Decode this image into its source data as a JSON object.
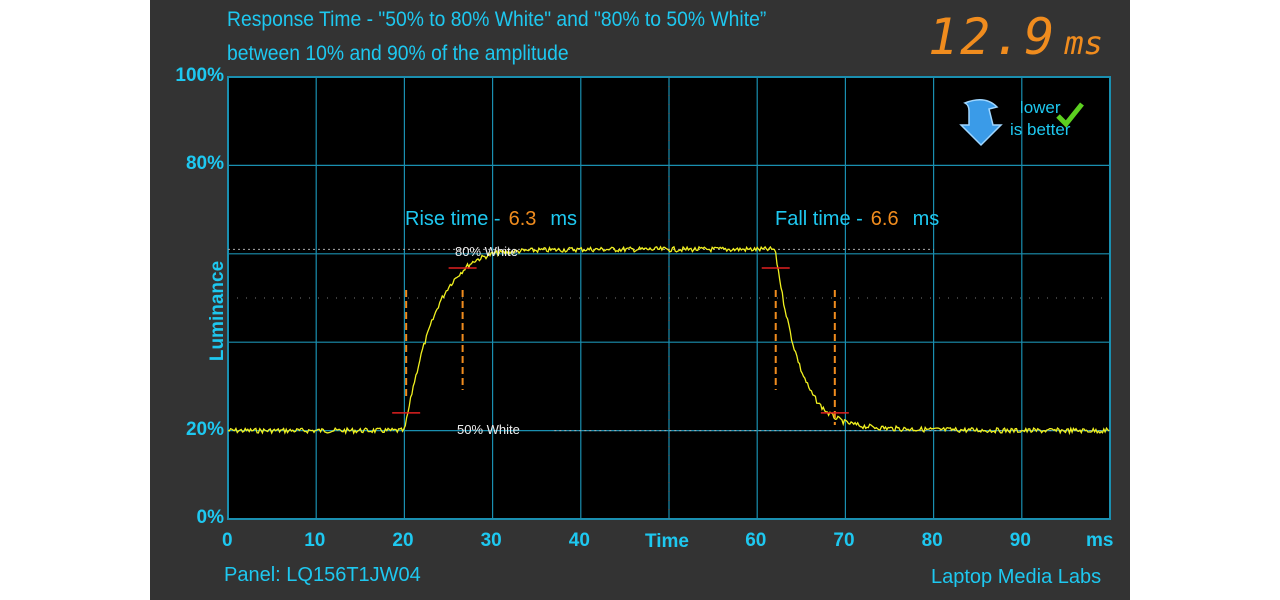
{
  "header": {
    "title_line1": "Response Time - \"50% to 80% White\" and \"80% to 50% White”",
    "title_line2": "between 10% and 90% of the amplitude",
    "total_value": "12.9",
    "total_unit": "ms"
  },
  "badge": {
    "line1": "lower",
    "line2": "is better",
    "icon": "down-arrow-checkmark-icon"
  },
  "footer": {
    "panel": "Panel: LQ156T1JW04",
    "brand": "Laptop Media Labs"
  },
  "colors": {
    "background": "#333333",
    "plot": "#000000",
    "grid": "#1a8fb0",
    "text": "#1ec8f0",
    "accent": "#f08c1e",
    "trace": "#f0f020",
    "marker": "#e02020"
  },
  "chart_data": {
    "type": "line",
    "ylabel": "Luminance",
    "xlabel": "Time",
    "xunit": "ms",
    "xlim": [
      0,
      100
    ],
    "ylim": [
      0,
      100
    ],
    "xticks": [
      "0",
      "10",
      "20",
      "30",
      "40",
      "",
      "60",
      "70",
      "80",
      "90"
    ],
    "yticks": [
      {
        "value": 0,
        "label": "0%"
      },
      {
        "value": 20,
        "label": "20%"
      },
      {
        "value": 80,
        "label": "80%"
      },
      {
        "value": 100,
        "label": "100%"
      }
    ],
    "grid": true,
    "levels": [
      {
        "label": "80% White",
        "value": 61
      },
      {
        "label": "50% White",
        "value": 20
      }
    ],
    "annotations": {
      "rise_label": "Rise time -",
      "rise_value": "6.3",
      "fall_label": "Fall time -",
      "fall_value": "6.6",
      "unit": "ms"
    },
    "rise_markers_ms": [
      20.2,
      26.6
    ],
    "fall_markers_ms": [
      62.1,
      68.8
    ],
    "series": [
      {
        "x": [
          0,
          20,
          21,
          22,
          23,
          24,
          25,
          26,
          27,
          28,
          29,
          30,
          32,
          35,
          40,
          50,
          62,
          63,
          64,
          65,
          66,
          67,
          68,
          69,
          70,
          72,
          75,
          80,
          90,
          100
        ],
        "y": [
          20,
          20,
          30,
          38,
          44,
          49,
          52.5,
          55,
          57,
          58.5,
          59.3,
          60,
          60.5,
          60.8,
          61,
          61,
          61,
          49,
          40,
          33.5,
          29,
          26,
          24,
          22.8,
          21.8,
          21,
          20.5,
          20.2,
          20,
          20
        ]
      }
    ]
  }
}
